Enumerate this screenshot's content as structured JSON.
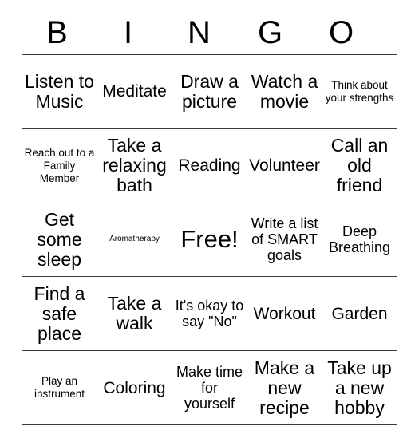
{
  "card": {
    "title": "BINGO",
    "header_letters": [
      "B",
      "I",
      "N",
      "G",
      "O"
    ],
    "columns": 5,
    "rows": 5,
    "colors": {
      "background": "#ffffff",
      "border": "#3a3a3a",
      "text": "#000000"
    },
    "free_space": {
      "row": 2,
      "col": 2,
      "label": "Free!"
    },
    "grid": [
      [
        {
          "label": "Listen to Music",
          "size": "lg"
        },
        {
          "label": "Meditate",
          "size": "md"
        },
        {
          "label": "Draw a picture",
          "size": "lg"
        },
        {
          "label": "Watch a movie",
          "size": "lg"
        },
        {
          "label": "Think about your strengths",
          "size": "xs"
        }
      ],
      [
        {
          "label": "Reach out to a Family Member",
          "size": "xs"
        },
        {
          "label": "Take a relaxing bath",
          "size": "lg"
        },
        {
          "label": "Reading",
          "size": "md"
        },
        {
          "label": "Volunteer",
          "size": "md"
        },
        {
          "label": "Call an old friend",
          "size": "lg"
        }
      ],
      [
        {
          "label": "Get some sleep",
          "size": "lg"
        },
        {
          "label": "Aromatherapy",
          "size": "xxs"
        },
        {
          "label": "Free!",
          "size": "xl"
        },
        {
          "label": "Write a list of SMART goals",
          "size": "sm"
        },
        {
          "label": "Deep Breathing",
          "size": "sm"
        }
      ],
      [
        {
          "label": "Find a safe place",
          "size": "lg"
        },
        {
          "label": "Take a walk",
          "size": "lg"
        },
        {
          "label": "It's okay to say \"No\"",
          "size": "sm"
        },
        {
          "label": "Workout",
          "size": "md"
        },
        {
          "label": "Garden",
          "size": "md"
        }
      ],
      [
        {
          "label": "Play an instrument",
          "size": "xs"
        },
        {
          "label": "Coloring",
          "size": "md"
        },
        {
          "label": "Make time for yourself",
          "size": "sm"
        },
        {
          "label": "Make a new recipe",
          "size": "lg"
        },
        {
          "label": "Take up a new hobby",
          "size": "lg"
        }
      ]
    ]
  }
}
